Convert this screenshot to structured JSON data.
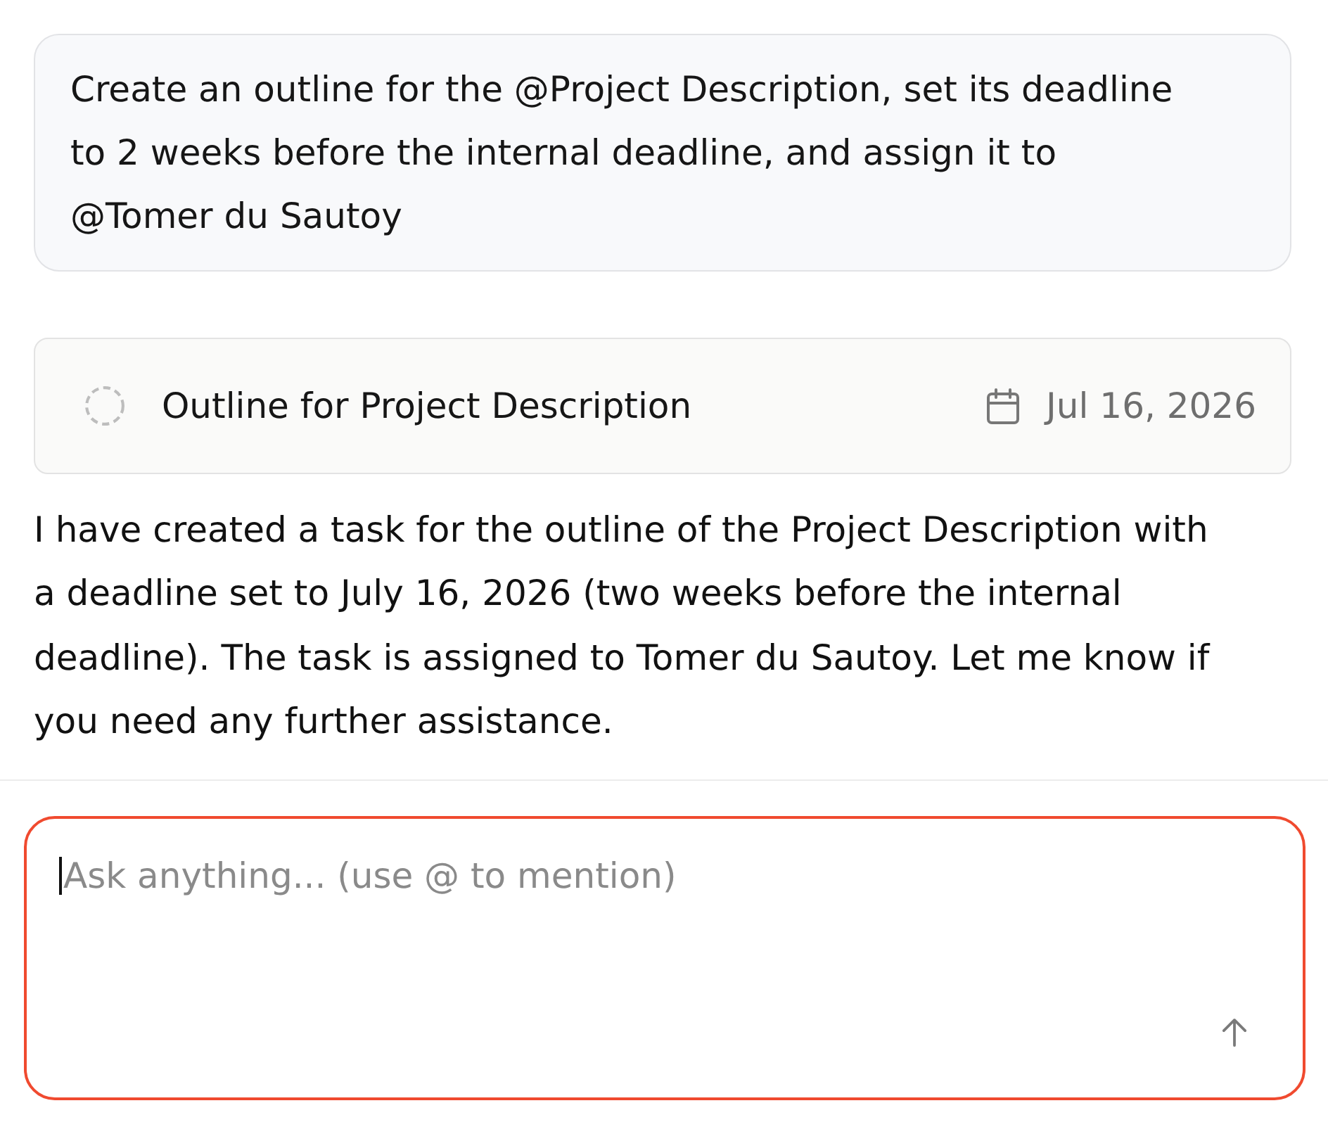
{
  "user_message": {
    "text": "Create an outline for the @Project Description, set its deadline to 2 weeks before the internal deadline, and assign it to @Tomer du Sautoy"
  },
  "task_card": {
    "done": false,
    "title": "Outline for Project Description",
    "due_date": "Jul 16, 2026"
  },
  "assistant_reply": {
    "text": "I have created a task for the outline of the Project Description with a deadline set to July 16, 2026 (two weeks before the internal deadline). The task is assigned to Tomer du Sautoy. Let me know if you need any further assistance."
  },
  "composer": {
    "placeholder": "Ask anything... (use @ to mention)",
    "focused": true
  }
}
